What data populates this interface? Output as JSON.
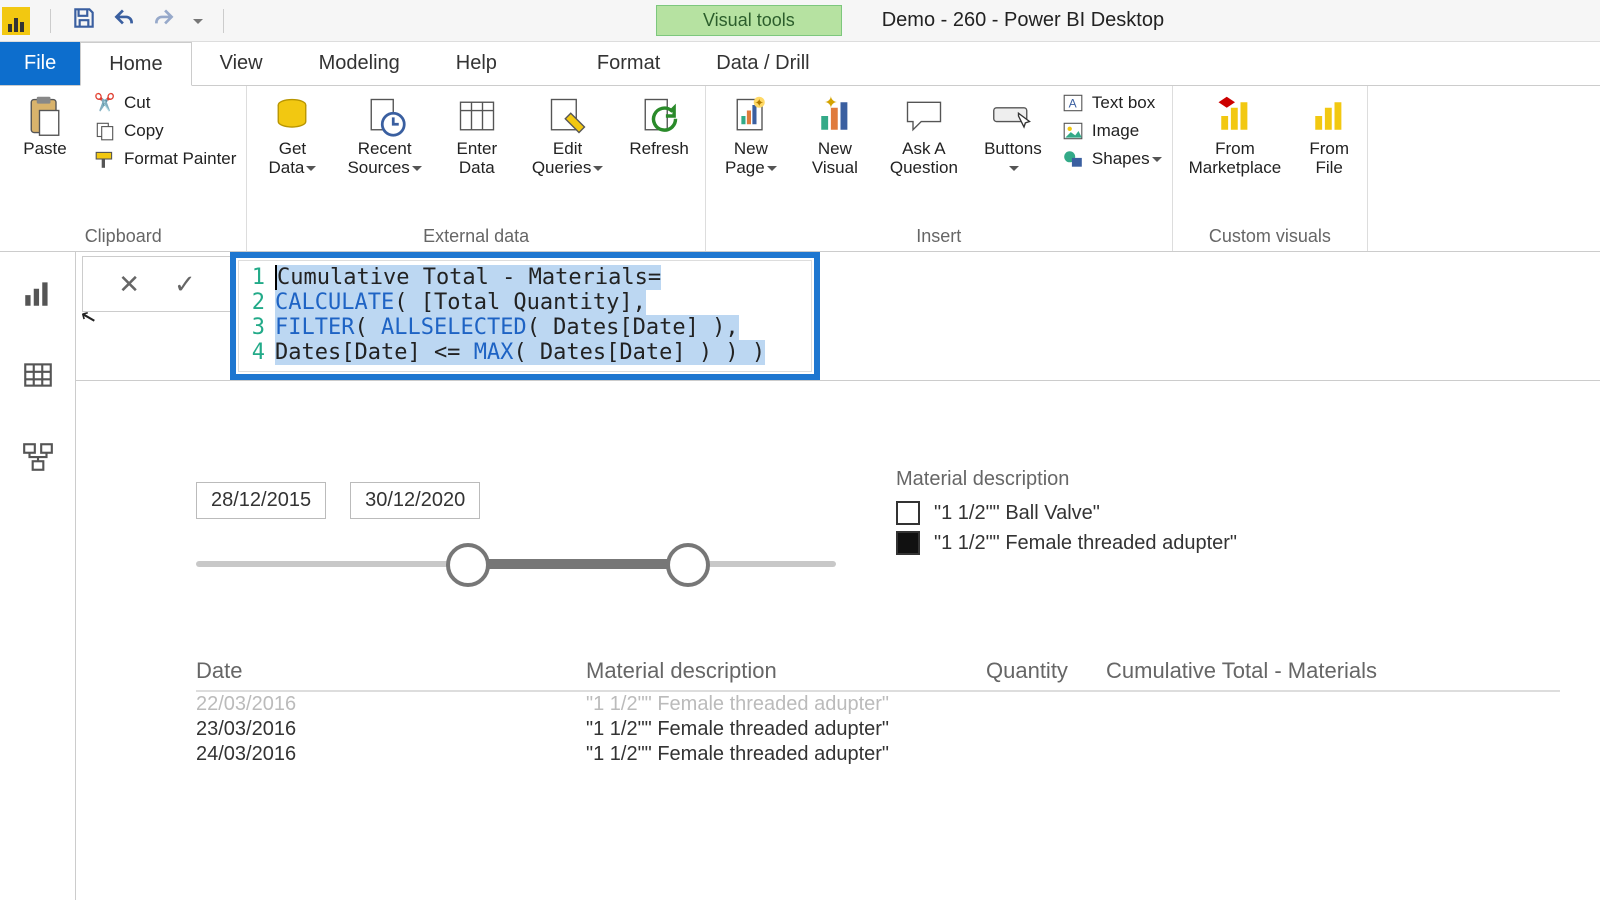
{
  "title_bar": {
    "contextual_tab": "Visual tools",
    "document_title": "Demo - 260 - Power BI Desktop"
  },
  "tabs": {
    "file": "File",
    "home": "Home",
    "view": "View",
    "modeling": "Modeling",
    "help": "Help",
    "format": "Format",
    "data_drill": "Data / Drill"
  },
  "ribbon": {
    "clipboard": {
      "label": "Clipboard",
      "paste": "Paste",
      "cut": "Cut",
      "copy": "Copy",
      "format_painter": "Format Painter"
    },
    "external": {
      "label": "External data",
      "get_data": "Get\nData",
      "recent": "Recent\nSources",
      "enter": "Enter\nData",
      "edit": "Edit\nQueries",
      "refresh": "Refresh"
    },
    "insert": {
      "label": "Insert",
      "new_page": "New\nPage",
      "new_visual": "New\nVisual",
      "ask": "Ask A\nQuestion",
      "buttons": "Buttons",
      "text_box": "Text box",
      "image": "Image",
      "shapes": "Shapes"
    },
    "custom": {
      "label": "Custom visuals",
      "marketplace": "From\nMarketplace",
      "file": "From\nFile"
    }
  },
  "formula": {
    "l1a": "Cumulative Total - Materials ",
    "l1b": "=",
    "l2a": "CALCULATE",
    "l2b": "( ",
    "l2c": "[Total Quantity]",
    "l2d": ",",
    "l3a": "    ",
    "l3b": "FILTER",
    "l3c": "( ",
    "l3d": "ALLSELECTED",
    "l3e": "( Dates[Date] ),",
    "l4a": "        Dates[Date] <= ",
    "l4b": "MAX",
    "l4c": "( Dates[Date] ) ) )"
  },
  "slicer": {
    "start": "28/12/2015",
    "end": "30/12/2020"
  },
  "legend": {
    "title": "Material description",
    "item1": "\"1 1/2\"\" Ball Valve\"",
    "item2": "\"1 1/2\"\" Female threaded adupter\""
  },
  "table": {
    "h_date": "Date",
    "h_mat": "Material description",
    "h_qty": "Quantity",
    "h_cum": "Cumulative Total - Materials",
    "r0_date": "22/03/2016",
    "r0_mat": "\"1 1/2\"\" Female threaded adupter\"",
    "r1_date": "23/03/2016",
    "r1_mat": "\"1 1/2\"\" Female threaded adupter\"",
    "r2_date": "24/03/2016",
    "r2_mat": "\"1 1/2\"\" Female threaded adupter\""
  }
}
